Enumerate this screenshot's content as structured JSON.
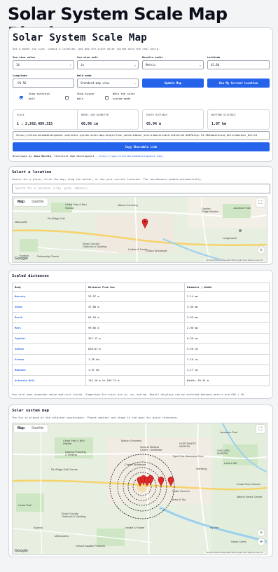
{
  "page_title": "Solar System Scale Map Plugin",
  "app": {
    "title": "Solar System Scale Map",
    "subtitle": "Set a model Sun size, choose a location, and map the scale solar system onto the real world.",
    "fields": {
      "sun_size_value": {
        "label": "Sun size value",
        "value": "14"
      },
      "sun_size_unit": {
        "label": "Sun size unit",
        "value": "in"
      },
      "results_units": {
        "label": "Results units",
        "value": "Metric"
      },
      "latitude": {
        "label": "Latitude",
        "value": "42.06"
      },
      "longitude": {
        "label": "Longitude",
        "value": "-91.56"
      },
      "walk_mode": {
        "label": "Walk mode",
        "value": "Standard map view"
      }
    },
    "buttons": {
      "update_map": "Update Map",
      "use_location": "Use My Current Location",
      "copy_link": "Copy Shareable Link"
    },
    "checkboxes": [
      {
        "label": "Show asteroid belt",
        "checked": true
      },
      {
        "label": "Show Kuiper belt",
        "checked": false
      },
      {
        "label": "Walk the solar system mode",
        "checked": false
      }
    ],
    "stats": [
      {
        "label": "SCALE",
        "value": "1 : 2,262,489,315"
      },
      {
        "label": "MODEL SUN DIAMETER",
        "value": "60.96 cm"
      },
      {
        "label": "EARTH DISTANCE",
        "value": "65.94 m"
      },
      {
        "label": "NEPTUNE DISTANCE",
        "value": "1.07 km"
      }
    ],
    "share_url": "https://celestialwebdevelopment.com/solar-system-scale-map-plugin/?sun_value=14&sun_unit=in&units=metric&lat=42.0467&lng=-91.5841&asteroid_belt=1&kuiper_belt=0",
    "credit": {
      "prefix": "Developed by ",
      "author": "John Martin",
      "mid": ", Celestial Web Development - ",
      "link": "https://www.celestialwebdevelopment.com/"
    }
  },
  "location": {
    "title": "Select a location",
    "help": "Search for a place, click the map, drag the marker, or use your current location. The coordinates update automatically.",
    "search_placeholder": "Search for a location (city, park, address)",
    "map_tabs": [
      "Map",
      "Satellite"
    ],
    "labels": [
      "Cedar Park & Bird Habitat",
      "Marion Cemetery",
      "Marion Ridge",
      "Brown",
      "Jacobson Park",
      "Garden Ridge",
      "Marionville",
      "Pin Ridge",
      "Costco Wholesale",
      "Cedar River Garden",
      "Cedar Rapids Sports Complex",
      "Lowe's Home Improvement",
      "Lindale & Fowler",
      "Longbranch",
      "Kacena"
    ],
    "attribution": "Keyboard shortcuts  Map data ©2026 Google  Terms  Report a map error"
  },
  "distances": {
    "title": "Scaled distances",
    "headers": [
      "Body",
      "Distance From Sun",
      "Diameter / Width"
    ],
    "rows": [
      [
        "Mercury",
        "25.57 m",
        "2.14 mm"
      ],
      [
        "Venus",
        "47.68 m",
        "5.38 mm"
      ],
      [
        "Earth",
        "65.94 m",
        "5.59 mm"
      ],
      [
        "Mars",
        "99.85 m",
        "2.98 mm"
      ],
      [
        "Jupiter",
        "341.12 m",
        "6.26 cm"
      ],
      [
        "Saturn",
        "628.81 m",
        "5.26 cm"
      ],
      [
        "Uranus",
        "1.26 km",
        "2.16 cm"
      ],
      [
        "Neptune",
        "1.97 km",
        "2.17 cm"
      ],
      [
        "Asteroid Belt",
        "144.10 m to 109.74 m",
        "Width: 65.51 m"
      ]
    ],
    "note": "Sun size uses separate value and unit fields. Supported Sun units are in, cm, and mm. Result displays can be switched between metric and SAE / US."
  },
  "solar_map": {
    "title": "Solar system map",
    "help": "The Sun is placed at the selected coordinates. Planet markers are shown in the most for quick reference.",
    "map_tabs": [
      "Map",
      "Satellite"
    ],
    "labels": [
      "Cedar Park & Bird Habitat",
      "Harmon Pumping & Heating",
      "Marion Cemetery",
      "Ground Medical Center - Northeast",
      "NORTHWEST MARION",
      "Pin Ridge Golf Course",
      "Toys R Us Discovery Zone",
      "OAKLAND MARION",
      "Lowe's Hill",
      "Costco Wholesale",
      "Wartburg",
      "Dollar General",
      "Cedar River Garden",
      "Brew & Tea",
      "Marion Senior Center",
      "Snow Country Outdoors & Sporting",
      "Hy-Vee",
      "McDonald's",
      "Lindale & Fowler",
      "Indian Creek",
      "Leisure Aquatic Products",
      "Jacobson Park",
      "Kacena"
    ],
    "attribution": "Keyboard shortcuts  Map data ©2026 Google  Terms  Report a map error"
  }
}
